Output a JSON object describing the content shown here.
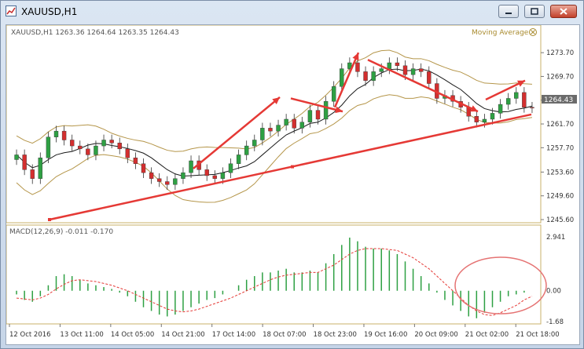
{
  "window": {
    "title": "XAUUSD,H1",
    "buttons": [
      "minimize",
      "restore",
      "close"
    ]
  },
  "main_chart": {
    "header": "XAUUSD,H1  1263.36 1264.64 1263.35 1264.43",
    "indicator_label": "Moving Average",
    "current_price_label": "1264.43",
    "current_price": 1264.43
  },
  "macd_panel": {
    "header": "MACD(12,26,9) -0.011 -0.170"
  },
  "chart_data": [
    {
      "type": "candlestick",
      "title": "XAUUSD,H1",
      "ylim": [
        1245.6,
        1275.7
      ],
      "y_ticks": [
        1273.7,
        1269.7,
        1265.7,
        1261.7,
        1257.7,
        1253.6,
        1249.6,
        1245.6
      ],
      "y_tick_labels": [
        "1273.70",
        "1269.70",
        "1265.70",
        "1261.70",
        "1257.70",
        "1253.60",
        "1249.60",
        "1245.60"
      ],
      "close_series": [
        1256.5,
        1254.0,
        1252.5,
        1256.0,
        1259.5,
        1260.5,
        1259.0,
        1258.0,
        1257.5,
        1256.5,
        1258.0,
        1259.0,
        1258.5,
        1257.5,
        1256.0,
        1255.0,
        1253.5,
        1252.5,
        1252.0,
        1251.5,
        1252.5,
        1253.5,
        1255.5,
        1254.0,
        1253.0,
        1252.5,
        1253.5,
        1255.0,
        1256.5,
        1258.0,
        1259.0,
        1261.0,
        1260.5,
        1261.5,
        1262.5,
        1261.0,
        1262.0,
        1264.0,
        1262.5,
        1265.5,
        1268.0,
        1271.0,
        1272.0,
        1270.5,
        1269.0,
        1270.5,
        1271.0,
        1272.0,
        1271.5,
        1270.0,
        1271.0,
        1270.5,
        1268.5,
        1266.0,
        1266.5,
        1265.5,
        1264.5,
        1263.0,
        1262.0,
        1262.5,
        1263.5,
        1265.0,
        1266.0,
        1267.0,
        1264.5,
        1264.43
      ],
      "x_tick_labels": [
        "12 Oct 2016",
        "13 Oct 11:00",
        "14 Oct 05:00",
        "14 Oct 21:00",
        "17 Oct 14:00",
        "18 Oct 07:00",
        "18 Oct 23:00",
        "19 Oct 16:00",
        "20 Oct 09:00",
        "21 Oct 02:00",
        "21 Oct 18:00"
      ],
      "overlays": [
        "Moving Average",
        "Bollinger Bands",
        "Support trendline",
        "Trend arrows"
      ]
    },
    {
      "type": "bar",
      "title": "MACD(12,26,9)",
      "ylim": [
        -1.68,
        2.941
      ],
      "y_tick_labels": [
        "2.941",
        "0.00",
        "-1.68"
      ],
      "histogram": [
        -0.2,
        -0.5,
        -0.6,
        -0.3,
        0.3,
        0.8,
        0.9,
        0.8,
        0.6,
        0.4,
        0.3,
        0.2,
        0.1,
        -0.1,
        -0.3,
        -0.6,
        -0.9,
        -1.1,
        -1.3,
        -1.4,
        -1.3,
        -1.1,
        -0.9,
        -0.7,
        -0.5,
        -0.4,
        -0.2,
        0.0,
        0.3,
        0.6,
        0.8,
        1.0,
        1.0,
        1.1,
        1.2,
        1.0,
        1.0,
        1.1,
        1.0,
        1.5,
        2.0,
        2.5,
        2.9,
        2.7,
        2.4,
        2.3,
        2.3,
        2.2,
        2.0,
        1.6,
        1.2,
        0.8,
        0.4,
        -0.1,
        -0.5,
        -0.8,
        -1.1,
        -1.4,
        -1.5,
        -1.2,
        -0.9,
        -0.6,
        -0.3,
        -0.2,
        -0.1,
        0.0
      ],
      "signal": [
        -0.4,
        -0.45,
        -0.5,
        -0.4,
        -0.2,
        0.1,
        0.35,
        0.55,
        0.6,
        0.55,
        0.5,
        0.4,
        0.3,
        0.15,
        0.0,
        -0.2,
        -0.4,
        -0.6,
        -0.8,
        -1.0,
        -1.1,
        -1.15,
        -1.1,
        -1.0,
        -0.85,
        -0.7,
        -0.55,
        -0.4,
        -0.2,
        0.0,
        0.2,
        0.4,
        0.6,
        0.75,
        0.85,
        0.9,
        0.95,
        1.0,
        1.0,
        1.2,
        1.4,
        1.7,
        2.0,
        2.2,
        2.3,
        2.3,
        2.3,
        2.25,
        2.2,
        2.0,
        1.8,
        1.5,
        1.2,
        0.8,
        0.4,
        0.0,
        -0.4,
        -0.8,
        -1.1,
        -1.3,
        -1.35,
        -1.2,
        -1.0,
        -0.8,
        -0.5,
        -0.3
      ]
    }
  ]
}
